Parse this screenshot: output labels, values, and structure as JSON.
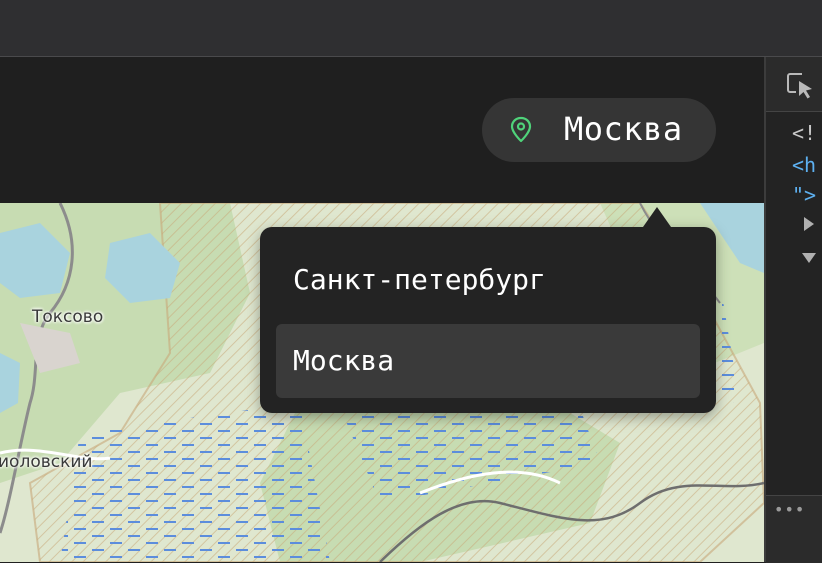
{
  "header": {
    "selected_city": "Москва",
    "pin_icon": "map-pin-icon",
    "accent_color": "#4fd37a"
  },
  "city_dropdown": {
    "options": [
      {
        "label": "Санкт-петербург",
        "selected": false
      },
      {
        "label": "Москва",
        "selected": true
      }
    ]
  },
  "map": {
    "labels": [
      "Токсово",
      "иоловский"
    ]
  },
  "devtools": {
    "inspect_icon": "inspect-element-icon",
    "lines": [
      "<!",
      "<h",
      "\">"
    ],
    "more_label": "•••"
  }
}
